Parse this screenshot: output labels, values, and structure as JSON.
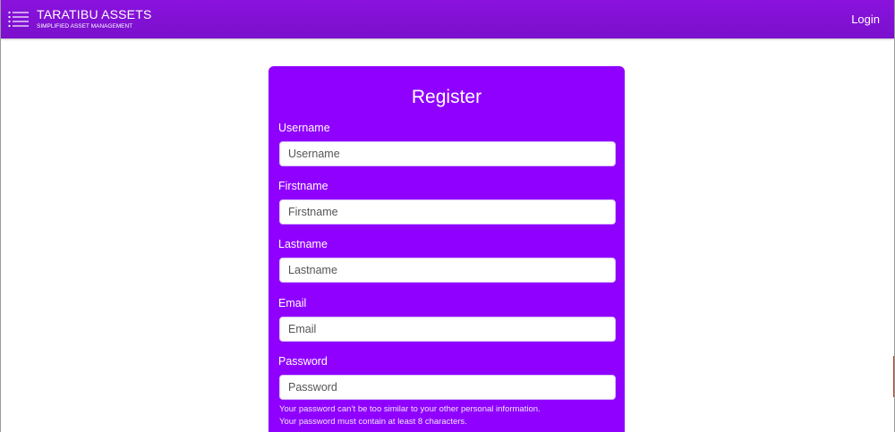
{
  "navbar": {
    "brand_title": "TARATIBU ASSETS",
    "brand_subtitle": "SIMPLIFIED ASSET MANAGEMENT",
    "menu_icon": "hamburger-menu-icon",
    "login_label": "Login"
  },
  "register": {
    "title": "Register",
    "fields": [
      {
        "label": "Username",
        "placeholder": "Username",
        "value": ""
      },
      {
        "label": "Firstname",
        "placeholder": "Firstname",
        "value": ""
      },
      {
        "label": "Lastname",
        "placeholder": "Lastname",
        "value": ""
      },
      {
        "label": "Email",
        "placeholder": "Email",
        "value": ""
      },
      {
        "label": "Password",
        "placeholder": "Password",
        "value": ""
      }
    ],
    "password_help": [
      "Your password can’t be too similar to your other personal information.",
      "Your password must contain at least 8 characters."
    ]
  },
  "colors": {
    "navbar": "#8a12dd",
    "card": "#9000ff",
    "text_on_brand": "#ffffff"
  }
}
